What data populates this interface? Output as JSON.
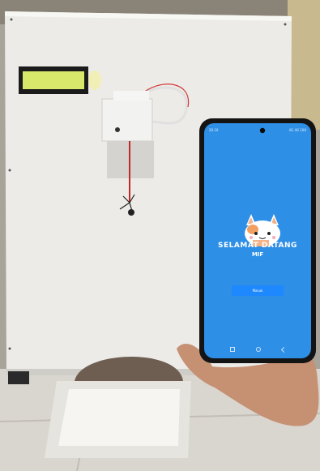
{
  "phone": {
    "status_time": "20.10",
    "status_icons": "4G 4G 100",
    "splash_title": "SELAMAT DATANG",
    "splash_subtitle": "MIF",
    "button_label": "Masuk",
    "screen_color": "#2d8fe6"
  },
  "device": {
    "lcd_color": "#d8e86a",
    "panel_color": "#eeeeec"
  }
}
